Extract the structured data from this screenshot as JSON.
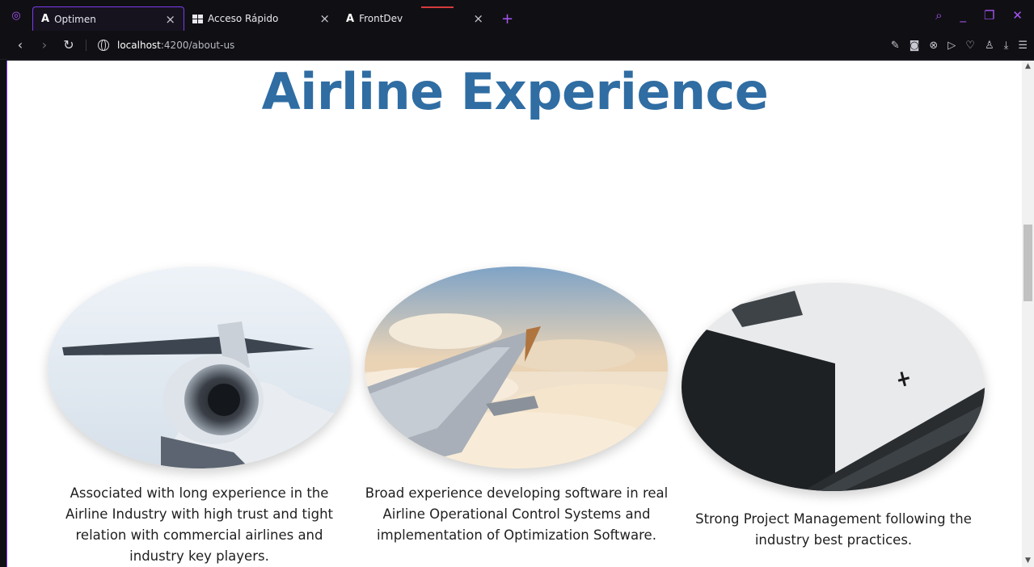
{
  "browser": {
    "tabs": [
      {
        "title": "Optimen",
        "active": true,
        "icon": "angular-icon"
      },
      {
        "title": "Acceso Rápido",
        "active": false,
        "icon": "grid-icon"
      },
      {
        "title": "FrontDev",
        "active": false,
        "icon": "angular-icon"
      }
    ],
    "tab_close_glyph": "×",
    "new_tab_glyph": "+",
    "url_host": "localhost",
    "url_path": ":4200/about-us",
    "accent_color": "#a855f7"
  },
  "page": {
    "title": "Airline Experience",
    "title_color": "#2f6da3",
    "features": [
      {
        "image": "jet-engine-image",
        "caption": "Associated with long experience in the Airline Industry with high trust and tight relation with commercial airlines and industry key players."
      },
      {
        "image": "plane-wing-clouds-image",
        "caption": "Broad experience developing software in real Airline Operational Control Systems and implementation of Optimization Software."
      },
      {
        "image": "skyscrapers-airplane-image",
        "caption": "Strong Project Management following the industry best practices."
      }
    ]
  }
}
